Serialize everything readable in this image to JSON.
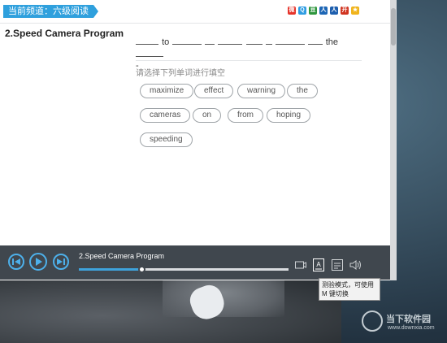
{
  "header": {
    "channel_label": "当前频道：六级阅读",
    "share_icons": [
      {
        "name": "weibo-icon",
        "color": "#e6332a",
        "glyph": "微"
      },
      {
        "name": "qzone-icon",
        "color": "#2f9de2",
        "glyph": "Q"
      },
      {
        "name": "douban-icon",
        "color": "#2e963d",
        "glyph": "豆"
      },
      {
        "name": "renren-icon",
        "color": "#1d66b5",
        "glyph": "人"
      },
      {
        "name": "people-icon",
        "color": "#1e5fae",
        "glyph": "人"
      },
      {
        "name": "kaixin-icon",
        "color": "#d0331f",
        "glyph": "开"
      },
      {
        "name": "star-icon",
        "color": "#f0b41c",
        "glyph": "★"
      }
    ]
  },
  "main": {
    "title": "2.Speed Camera Program",
    "sentence_words": [
      "to",
      "the"
    ],
    "sentence_trailing": "-",
    "instruction": "请选择下列单词进行填空",
    "options": [
      "maximize",
      "effect",
      "warning",
      "the",
      "cameras",
      "on",
      "from",
      "hoping",
      "speeding"
    ]
  },
  "player": {
    "track_title": "2.Speed Camera Program",
    "progress": 0.3,
    "accent_color": "#3ea3dc",
    "tooltip": "测验模式，可使用 M 键切换"
  },
  "watermark": {
    "name": "当下软件园",
    "url": "www.downxia.com"
  }
}
